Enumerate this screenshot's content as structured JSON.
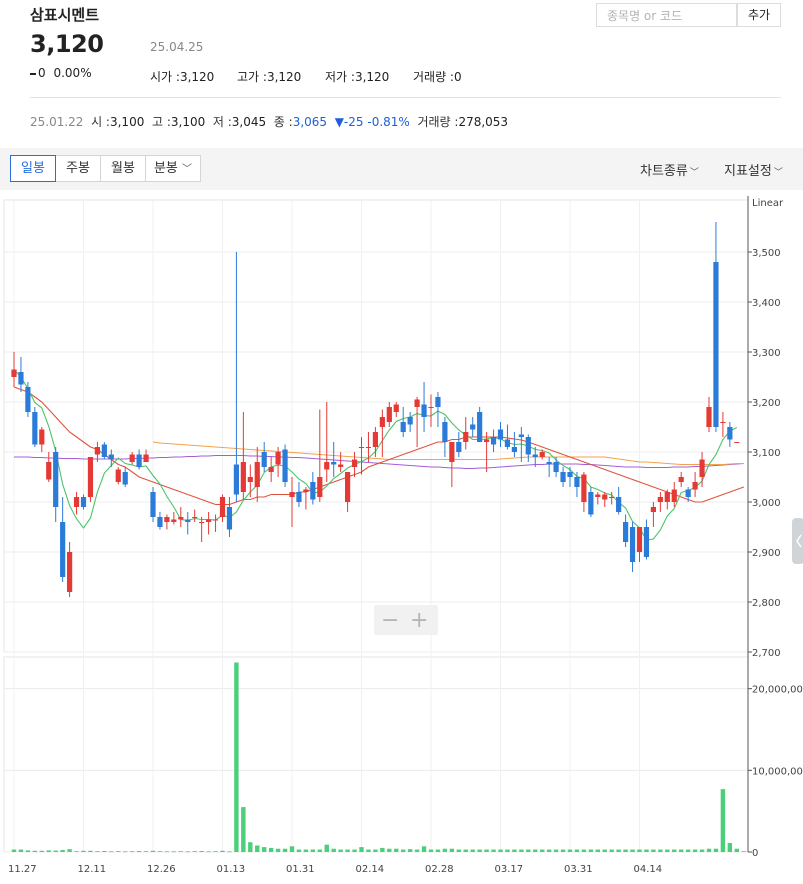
{
  "header": {
    "stock_name": "삼표시멘트",
    "price": "3,120",
    "date": "25.04.25",
    "change": "0",
    "change_pct": "0.00%",
    "open_label": "시가 :",
    "open": "3,120",
    "high_label": "고가 :",
    "high": "3,120",
    "low_label": "저가 :",
    "low": "3,120",
    "volume_label": "거래량 :",
    "volume": "0"
  },
  "search": {
    "placeholder": "종목명 or 코드",
    "add_label": "추가"
  },
  "prev_day": {
    "date": "25.01.22",
    "open_label": "시 :",
    "open": "3,100",
    "high_label": "고 :",
    "high": "3,100",
    "low_label": "저 :",
    "low": "3,045",
    "close_label": "종 :",
    "close": "3,065",
    "change": "▼-25",
    "change_pct": "-0.81%",
    "volume_label": "거래량 :",
    "volume": "278,053"
  },
  "toolbar": {
    "tabs": [
      "일봉",
      "주봉",
      "월봉",
      "분봉"
    ],
    "active_tab": 0,
    "chart_type_label": "차트종류",
    "indicator_label": "지표설정"
  },
  "colors": {
    "up": "#e53935",
    "down": "#2b7bd8",
    "ma5": "#4cc36b",
    "ma20": "#e0533d",
    "ma60": "#f0a34a",
    "ma120": "#a45ed8",
    "volume": "#4ccf7a"
  },
  "chart_data": {
    "type": "candlestick",
    "scale_label": "Linear",
    "price_axis": {
      "ylim": [
        2700,
        3560
      ],
      "ticks": [
        "3,500",
        "3,400",
        "3,300",
        "3,200",
        "3,100",
        "3,000",
        "2,900",
        "2,800",
        "2,700"
      ],
      "tick_values": [
        3500,
        3400,
        3300,
        3200,
        3100,
        3000,
        2900,
        2800,
        2700
      ]
    },
    "volume_axis": {
      "ylim": [
        0,
        24000000
      ],
      "ticks": [
        "20,000,000",
        "10,000,000",
        "0"
      ],
      "tick_values": [
        20000000,
        10000000,
        0
      ]
    },
    "x_ticks": [
      "11.27",
      "12.11",
      "12.26",
      "01.13",
      "01.31",
      "02.14",
      "02.28",
      "03.17",
      "03.31",
      "04.14"
    ],
    "x_tick_index": [
      0,
      10,
      20,
      30,
      40,
      50,
      60,
      70,
      80,
      90
    ],
    "grid": true,
    "zoom_minus": "−",
    "zoom_plus": "+",
    "candles": [
      {
        "o": 3250,
        "h": 3300,
        "l": 3230,
        "c": 3265
      },
      {
        "o": 3260,
        "h": 3290,
        "l": 3220,
        "c": 3235
      },
      {
        "o": 3230,
        "h": 3240,
        "l": 3170,
        "c": 3180
      },
      {
        "o": 3180,
        "h": 3190,
        "l": 3110,
        "c": 3115
      },
      {
        "o": 3115,
        "h": 3150,
        "l": 3100,
        "c": 3145
      },
      {
        "o": 3045,
        "h": 3100,
        "l": 3040,
        "c": 3080
      },
      {
        "o": 3100,
        "h": 3110,
        "l": 2960,
        "c": 2990
      },
      {
        "o": 2960,
        "h": 3010,
        "l": 2840,
        "c": 2850
      },
      {
        "o": 2820,
        "h": 2920,
        "l": 2810,
        "c": 2900
      },
      {
        "o": 2990,
        "h": 3020,
        "l": 2975,
        "c": 3010
      },
      {
        "o": 3010,
        "h": 3015,
        "l": 2985,
        "c": 2990
      },
      {
        "o": 3010,
        "h": 3090,
        "l": 3000,
        "c": 3090
      },
      {
        "o": 3095,
        "h": 3120,
        "l": 3080,
        "c": 3110
      },
      {
        "o": 3115,
        "h": 3120,
        "l": 3085,
        "c": 3090
      },
      {
        "o": 3095,
        "h": 3105,
        "l": 3070,
        "c": 3085
      },
      {
        "o": 3040,
        "h": 3070,
        "l": 3035,
        "c": 3065
      },
      {
        "o": 3060,
        "h": 3070,
        "l": 3030,
        "c": 3035
      },
      {
        "o": 3080,
        "h": 3100,
        "l": 3075,
        "c": 3095
      },
      {
        "o": 3095,
        "h": 3105,
        "l": 3065,
        "c": 3070
      },
      {
        "o": 3080,
        "h": 3105,
        "l": 3080,
        "c": 3095
      },
      {
        "o": 3020,
        "h": 3030,
        "l": 2960,
        "c": 2970
      },
      {
        "o": 2970,
        "h": 2980,
        "l": 2945,
        "c": 2950
      },
      {
        "o": 2960,
        "h": 2975,
        "l": 2945,
        "c": 2970
      },
      {
        "o": 2960,
        "h": 2980,
        "l": 2955,
        "c": 2965
      },
      {
        "o": 2965,
        "h": 2990,
        "l": 2950,
        "c": 2970
      },
      {
        "o": 2965,
        "h": 2980,
        "l": 2935,
        "c": 2960
      },
      {
        "o": 2970,
        "h": 2985,
        "l": 2960,
        "c": 2970
      },
      {
        "o": 2960,
        "h": 2970,
        "l": 2920,
        "c": 2960
      },
      {
        "o": 2960,
        "h": 2980,
        "l": 2935,
        "c": 2965
      },
      {
        "o": 2965,
        "h": 2975,
        "l": 2940,
        "c": 2965
      },
      {
        "o": 2970,
        "h": 3015,
        "l": 2960,
        "c": 3010
      },
      {
        "o": 2990,
        "h": 3010,
        "l": 2930,
        "c": 2945
      },
      {
        "o": 3075,
        "h": 3500,
        "l": 3000,
        "c": 3015
      },
      {
        "o": 3020,
        "h": 3180,
        "l": 3005,
        "c": 3080
      },
      {
        "o": 3040,
        "h": 3075,
        "l": 3010,
        "c": 3050
      },
      {
        "o": 3030,
        "h": 3110,
        "l": 3000,
        "c": 3080
      },
      {
        "o": 3100,
        "h": 3120,
        "l": 3060,
        "c": 3070
      },
      {
        "o": 3060,
        "h": 3090,
        "l": 3040,
        "c": 3070
      },
      {
        "o": 3075,
        "h": 3110,
        "l": 3050,
        "c": 3100
      },
      {
        "o": 3105,
        "h": 3115,
        "l": 3030,
        "c": 3040
      },
      {
        "o": 3010,
        "h": 3050,
        "l": 2950,
        "c": 3020
      },
      {
        "o": 3020,
        "h": 3040,
        "l": 2990,
        "c": 3000
      },
      {
        "o": 3020,
        "h": 3030,
        "l": 2985,
        "c": 3025
      },
      {
        "o": 3040,
        "h": 3060,
        "l": 2995,
        "c": 3005
      },
      {
        "o": 3010,
        "h": 3185,
        "l": 3000,
        "c": 3050
      },
      {
        "o": 3065,
        "h": 3200,
        "l": 3040,
        "c": 3080
      },
      {
        "o": 3080,
        "h": 3120,
        "l": 3050,
        "c": 3075
      },
      {
        "o": 3070,
        "h": 3100,
        "l": 3060,
        "c": 3075
      },
      {
        "o": 3000,
        "h": 3060,
        "l": 2980,
        "c": 3060
      },
      {
        "o": 3070,
        "h": 3100,
        "l": 3050,
        "c": 3085
      },
      {
        "o": 3110,
        "h": 3130,
        "l": 3055,
        "c": 3110
      },
      {
        "o": 3110,
        "h": 3140,
        "l": 3080,
        "c": 3110
      },
      {
        "o": 3110,
        "h": 3150,
        "l": 3090,
        "c": 3140
      },
      {
        "o": 3150,
        "h": 3185,
        "l": 3090,
        "c": 3170
      },
      {
        "o": 3160,
        "h": 3200,
        "l": 3150,
        "c": 3190
      },
      {
        "o": 3180,
        "h": 3200,
        "l": 3170,
        "c": 3195
      },
      {
        "o": 3160,
        "h": 3190,
        "l": 3130,
        "c": 3140
      },
      {
        "o": 3170,
        "h": 3180,
        "l": 3140,
        "c": 3155
      },
      {
        "o": 3190,
        "h": 3210,
        "l": 3110,
        "c": 3205
      },
      {
        "o": 3195,
        "h": 3240,
        "l": 3140,
        "c": 3170
      },
      {
        "o": 3190,
        "h": 3215,
        "l": 3150,
        "c": 3190
      },
      {
        "o": 3210,
        "h": 3220,
        "l": 3150,
        "c": 3190
      },
      {
        "o": 3160,
        "h": 3170,
        "l": 3090,
        "c": 3120
      },
      {
        "o": 3080,
        "h": 3120,
        "l": 3030,
        "c": 3120
      },
      {
        "o": 3120,
        "h": 3140,
        "l": 3090,
        "c": 3100
      },
      {
        "o": 3120,
        "h": 3170,
        "l": 3105,
        "c": 3140
      },
      {
        "o": 3155,
        "h": 3170,
        "l": 3130,
        "c": 3145
      },
      {
        "o": 3180,
        "h": 3190,
        "l": 3120,
        "c": 3120
      },
      {
        "o": 3120,
        "h": 3140,
        "l": 3060,
        "c": 3125
      },
      {
        "o": 3130,
        "h": 3145,
        "l": 3100,
        "c": 3115
      },
      {
        "o": 3145,
        "h": 3160,
        "l": 3110,
        "c": 3125
      },
      {
        "o": 3125,
        "h": 3155,
        "l": 3105,
        "c": 3110
      },
      {
        "o": 3110,
        "h": 3140,
        "l": 3090,
        "c": 3100
      },
      {
        "o": 3135,
        "h": 3150,
        "l": 3080,
        "c": 3130
      },
      {
        "o": 3130,
        "h": 3135,
        "l": 3080,
        "c": 3095
      },
      {
        "o": 3095,
        "h": 3110,
        "l": 3070,
        "c": 3090
      },
      {
        "o": 3090,
        "h": 3105,
        "l": 3085,
        "c": 3100
      },
      {
        "o": 3080,
        "h": 3090,
        "l": 3050,
        "c": 3075
      },
      {
        "o": 3080,
        "h": 3090,
        "l": 3050,
        "c": 3060
      },
      {
        "o": 3060,
        "h": 3070,
        "l": 3030,
        "c": 3040
      },
      {
        "o": 3060,
        "h": 3070,
        "l": 3030,
        "c": 3050
      },
      {
        "o": 3050,
        "h": 3060,
        "l": 3010,
        "c": 3030
      },
      {
        "o": 3000,
        "h": 3060,
        "l": 2980,
        "c": 3055
      },
      {
        "o": 3020,
        "h": 3030,
        "l": 2970,
        "c": 2975
      },
      {
        "o": 3010,
        "h": 3020,
        "l": 2995,
        "c": 3015
      },
      {
        "o": 3005,
        "h": 3020,
        "l": 2990,
        "c": 3015
      },
      {
        "o": 3010,
        "h": 3020,
        "l": 2995,
        "c": 3010
      },
      {
        "o": 3010,
        "h": 3030,
        "l": 2975,
        "c": 2980
      },
      {
        "o": 2960,
        "h": 2975,
        "l": 2910,
        "c": 2920
      },
      {
        "o": 2950,
        "h": 2960,
        "l": 2860,
        "c": 2880
      },
      {
        "o": 2900,
        "h": 2950,
        "l": 2880,
        "c": 2950
      },
      {
        "o": 2950,
        "h": 2965,
        "l": 2885,
        "c": 2890
      },
      {
        "o": 2980,
        "h": 3000,
        "l": 2950,
        "c": 2990
      },
      {
        "o": 3000,
        "h": 3020,
        "l": 2980,
        "c": 3010
      },
      {
        "o": 3000,
        "h": 3025,
        "l": 2985,
        "c": 3020
      },
      {
        "o": 3000,
        "h": 3040,
        "l": 2990,
        "c": 3025
      },
      {
        "o": 3040,
        "h": 3060,
        "l": 3030,
        "c": 3050
      },
      {
        "o": 3025,
        "h": 3030,
        "l": 3000,
        "c": 3010
      },
      {
        "o": 3025,
        "h": 3060,
        "l": 3010,
        "c": 3040
      },
      {
        "o": 3050,
        "h": 3100,
        "l": 3030,
        "c": 3085
      },
      {
        "o": 3150,
        "h": 3210,
        "l": 3140,
        "c": 3190
      },
      {
        "o": 3480,
        "h": 3560,
        "l": 3140,
        "c": 3150
      },
      {
        "o": 3160,
        "h": 3180,
        "l": 3130,
        "c": 3160
      },
      {
        "o": 3150,
        "h": 3160,
        "l": 3110,
        "c": 3125
      },
      {
        "o": 3120,
        "h": 3120,
        "l": 3120,
        "c": 3120
      }
    ],
    "volume": [
      300000,
      300000,
      200000,
      150000,
      150000,
      200000,
      180000,
      250000,
      350000,
      100000,
      150000,
      150000,
      100000,
      120000,
      80000,
      100000,
      80000,
      100000,
      120000,
      100000,
      150000,
      100000,
      80000,
      80000,
      100000,
      80000,
      100000,
      120000,
      80000,
      100000,
      150000,
      80000,
      23200000,
      5500000,
      1200000,
      800000,
      600000,
      500000,
      400000,
      400000,
      700000,
      300000,
      300000,
      300000,
      300000,
      900000,
      400000,
      300000,
      300000,
      300000,
      600000,
      300000,
      300000,
      500000,
      400000,
      400000,
      300000,
      350000,
      300000,
      700000,
      300000,
      300000,
      400000,
      400000,
      300000,
      300000,
      300000,
      300000,
      300000,
      300000,
      300000,
      300000,
      300000,
      300000,
      300000,
      300000,
      300000,
      300000,
      300000,
      300000,
      300000,
      300000,
      300000,
      300000,
      300000,
      300000,
      300000,
      300000,
      300000,
      300000,
      300000,
      300000,
      300000,
      300000,
      300000,
      300000,
      300000,
      300000,
      300000,
      300000,
      400000,
      400000,
      7700000,
      1100000,
      400000,
      100000
    ],
    "ma20": [
      3230,
      3225,
      3220,
      3210,
      3200,
      3185,
      3170,
      3155,
      3140,
      3130,
      3120,
      3110,
      3105,
      3095,
      3085,
      3075,
      3070,
      3060,
      3050,
      3045,
      3040,
      3035,
      3030,
      3025,
      3020,
      3015,
      3010,
      3005,
      3000,
      2995,
      2995,
      2995,
      3000,
      3005,
      3005,
      3010,
      3010,
      3015,
      3015,
      3015,
      3015,
      3020,
      3020,
      3025,
      3030,
      3035,
      3040,
      3045,
      3050,
      3055,
      3060,
      3070,
      3075,
      3080,
      3085,
      3090,
      3095,
      3100,
      3105,
      3110,
      3115,
      3120,
      3120,
      3125,
      3125,
      3130,
      3130,
      3130,
      3130,
      3130,
      3130,
      3128,
      3126,
      3124,
      3120,
      3115,
      3110,
      3105,
      3100,
      3095,
      3090,
      3085,
      3080,
      3075,
      3070,
      3065,
      3060,
      3055,
      3050,
      3045,
      3040,
      3035,
      3030,
      3025,
      3020,
      3015,
      3010,
      3005,
      3000,
      3000,
      3005,
      3010,
      3015,
      3020,
      3025,
      3030
    ],
    "ma60_start": 20,
    "ma60": [
      3120,
      3118,
      3117,
      3116,
      3115,
      3114,
      3113,
      3112,
      3111,
      3110,
      3109,
      3108,
      3107,
      3106,
      3105,
      3104,
      3103,
      3102,
      3101,
      3100,
      3099,
      3098,
      3097,
      3096,
      3095,
      3094,
      3093,
      3092,
      3091,
      3090,
      3089,
      3088,
      3087,
      3086,
      3085,
      3085,
      3085,
      3085,
      3085,
      3085,
      3085,
      3085,
      3085,
      3085,
      3085,
      3085,
      3085,
      3085,
      3085,
      3085,
      3086,
      3087,
      3088,
      3089,
      3090,
      3090,
      3090,
      3090,
      3090,
      3090,
      3090,
      3090,
      3090,
      3090,
      3090,
      3090,
      3088,
      3086,
      3084,
      3082,
      3080,
      3080,
      3079,
      3078,
      3077,
      3076,
      3075,
      3075,
      3075,
      3075,
      3075,
      3075,
      3075,
      3076,
      3077,
      3077
    ],
    "ma120": [
      3090,
      3090,
      3090,
      3089,
      3089,
      3088,
      3088,
      3087,
      3087,
      3087,
      3086,
      3086,
      3086,
      3086,
      3086,
      3086,
      3086,
      3087,
      3087,
      3088,
      3088,
      3089,
      3089,
      3090,
      3090,
      3091,
      3091,
      3092,
      3092,
      3093,
      3093,
      3093,
      3093,
      3093,
      3092,
      3092,
      3091,
      3091,
      3090,
      3090,
      3089,
      3089,
      3088,
      3087,
      3086,
      3085,
      3084,
      3083,
      3082,
      3081,
      3080,
      3079,
      3078,
      3077,
      3076,
      3075,
      3074,
      3073,
      3072,
      3071,
      3070,
      3070,
      3069,
      3068,
      3068,
      3067,
      3067,
      3068,
      3068,
      3069,
      3070,
      3071,
      3072,
      3073,
      3074,
      3075,
      3075,
      3076,
      3076,
      3076,
      3076,
      3076,
      3075,
      3075,
      3074,
      3073,
      3072,
      3071,
      3070,
      3070,
      3070,
      3069,
      3069,
      3069,
      3069,
      3070,
      3070,
      3070,
      3071,
      3071,
      3072,
      3073,
      3074,
      3075,
      3076,
      3077
    ]
  }
}
